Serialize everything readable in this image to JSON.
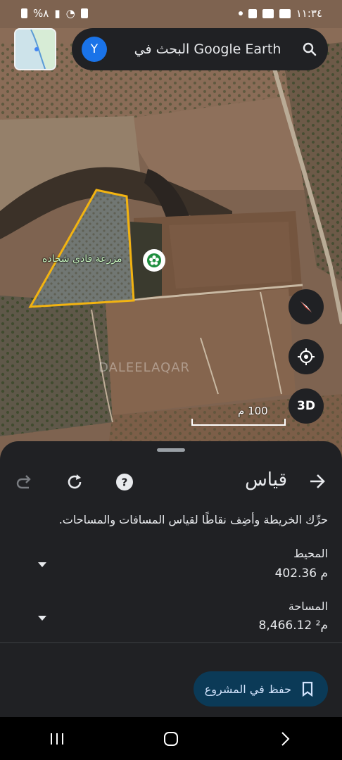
{
  "status_bar": {
    "time": "١١:٣٤",
    "battery": "%٨"
  },
  "search": {
    "avatar_letter": "Y",
    "placeholder": "البحث في Google Earth"
  },
  "map": {
    "place_label": "مزرعة فادي شحاده",
    "watermark": "DALEELAQAR",
    "scale_label": "100 م",
    "btn_3d": "3D"
  },
  "sheet": {
    "title": "قياس",
    "instructions": "حرِّك الخريطة وأضِف نقاطًا لقياس المسافات والمساحات.",
    "perimeter_label": "المحيط",
    "perimeter_value": "402.36 م",
    "area_label": "المساحة",
    "area_value": "8,466.12 م²",
    "save_label": "حفظ في المشروع"
  },
  "colors": {
    "polygon_stroke": "#f2b311",
    "sheet_bg": "#202124",
    "save_bg": "#0b3a57",
    "accent_blue": "#1a73e8"
  },
  "icons": [
    "back-arrow-icon",
    "help-icon",
    "reset-icon",
    "redo-icon",
    "dropdown-icon",
    "bookmark-icon",
    "search-icon",
    "compass-icon",
    "my-location-icon"
  ]
}
